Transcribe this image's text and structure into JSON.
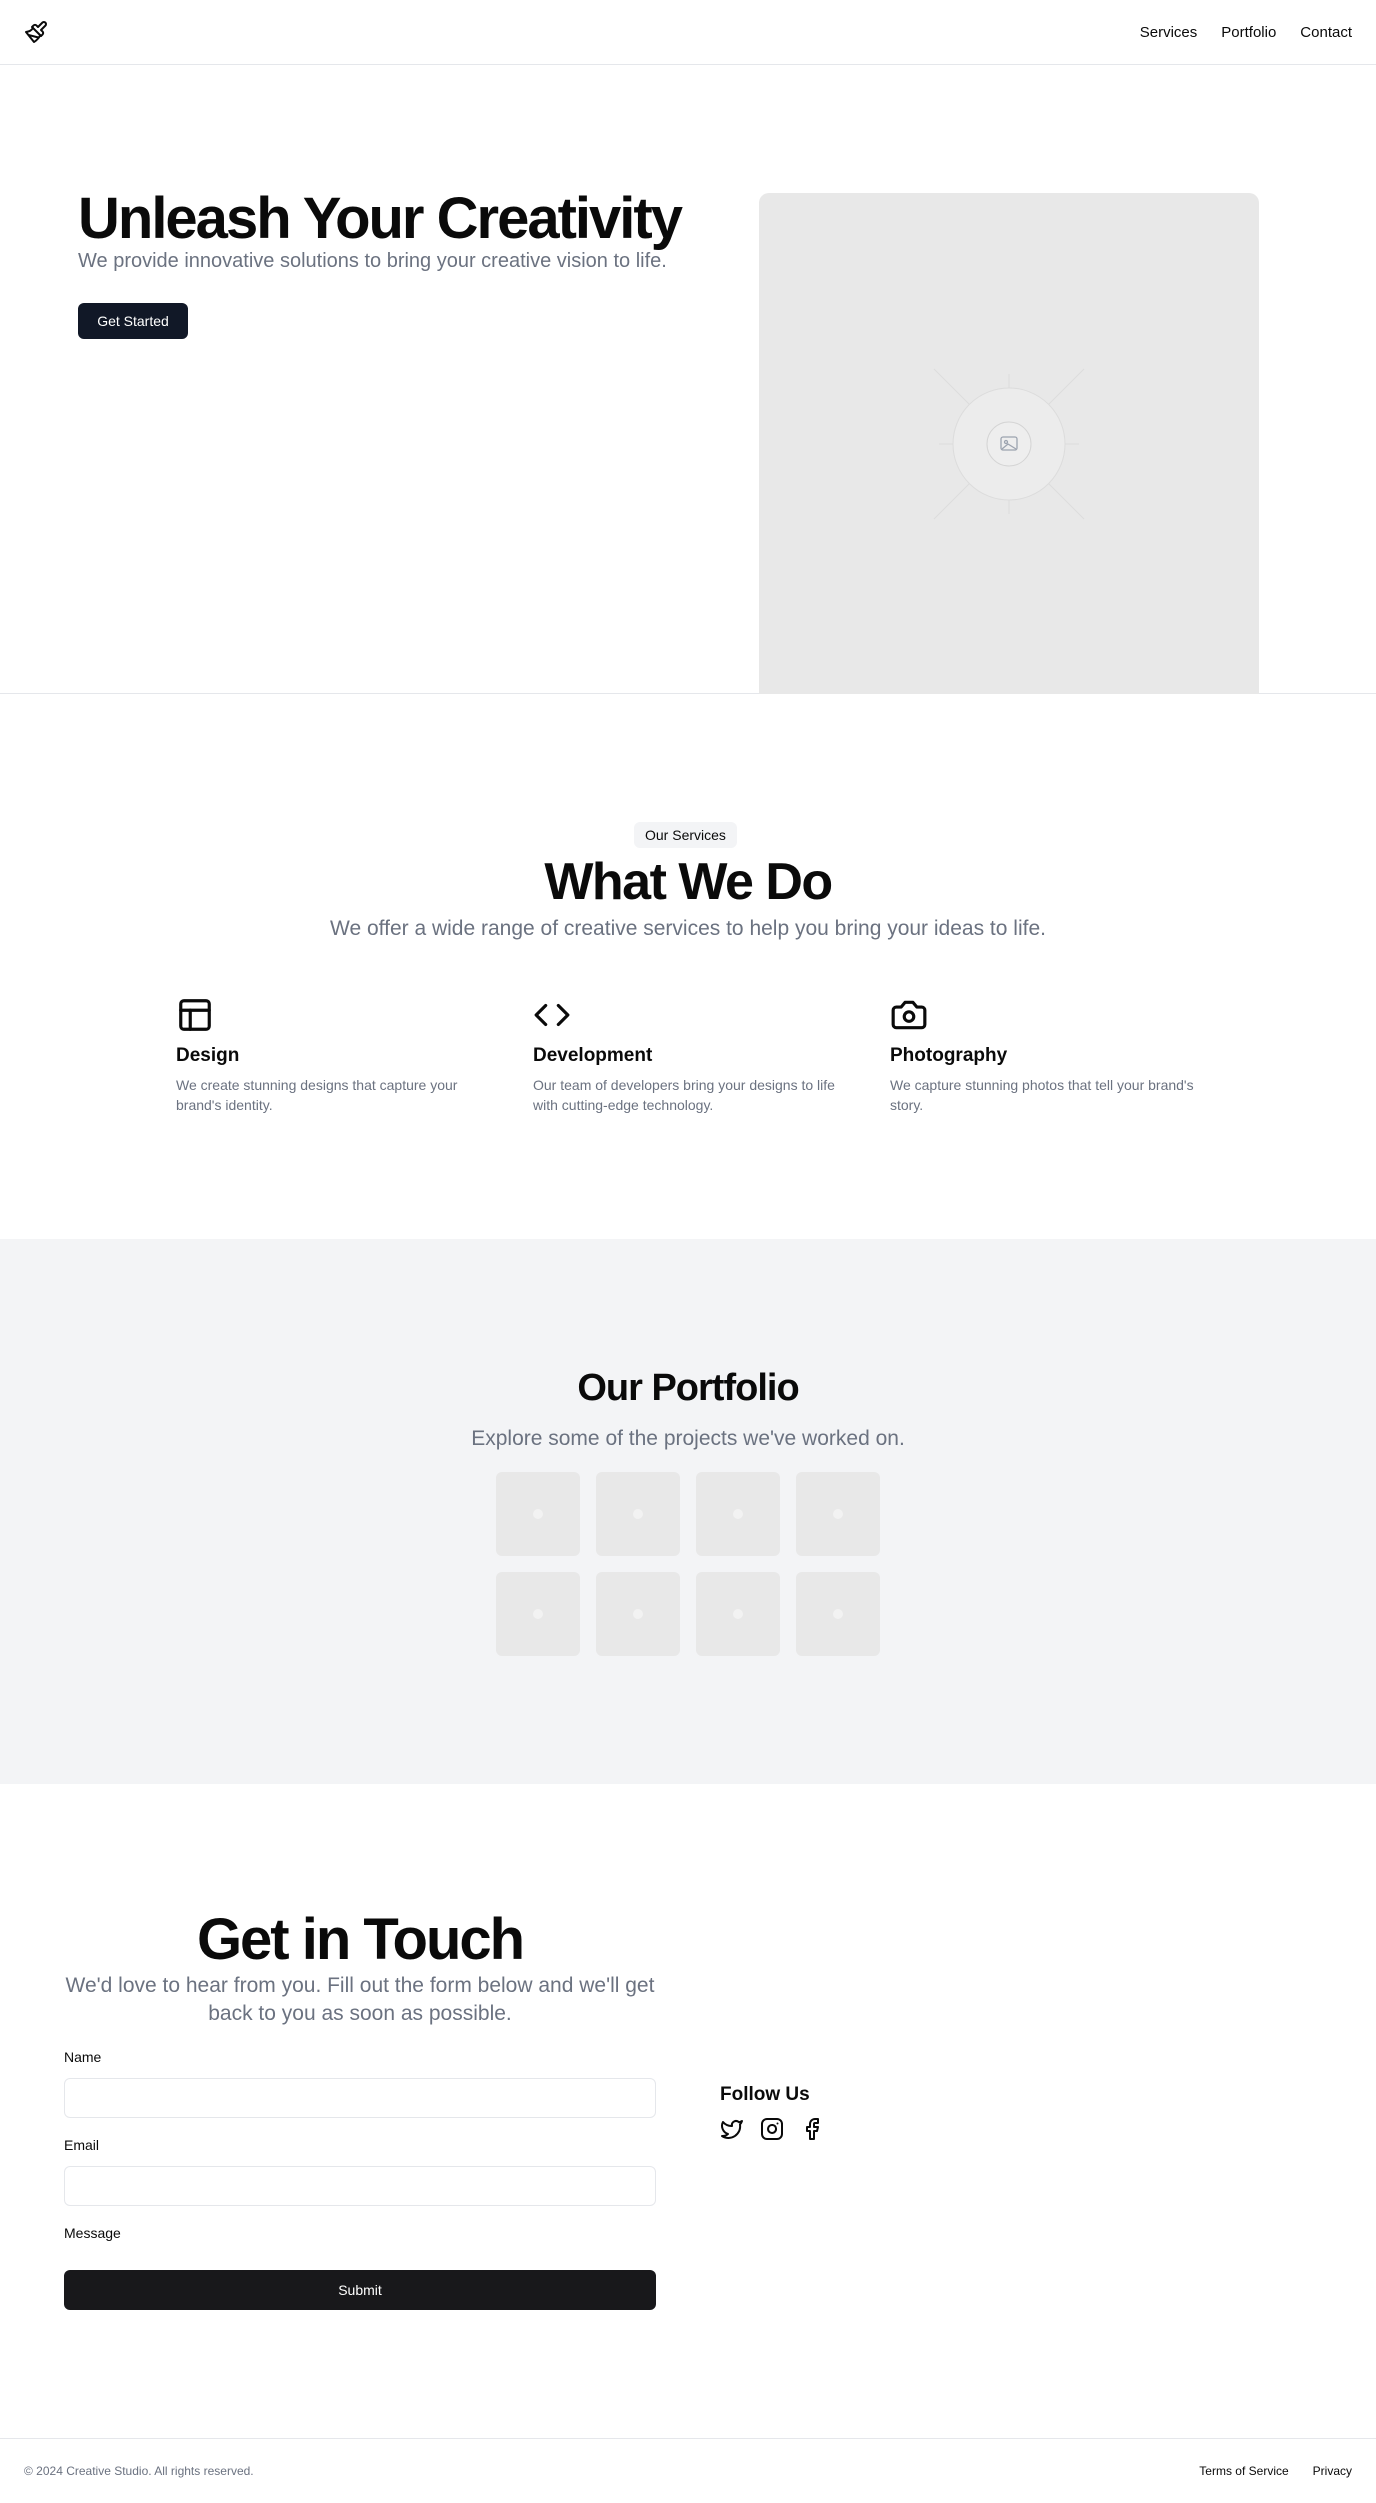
{
  "header": {
    "logo_icon": "paintbrush-icon",
    "nav": [
      "Services",
      "Portfolio",
      "Contact"
    ]
  },
  "hero": {
    "title": "Unleash Your Creativity",
    "subtitle": "We provide innovative solutions to bring your creative vision to life.",
    "cta_label": "Get Started",
    "image_icon": "image-placeholder-icon"
  },
  "services": {
    "badge": "Our Services",
    "title": "What We Do",
    "subtitle": "We offer a wide range of creative services to help you bring your ideas to life.",
    "items": [
      {
        "icon": "layout-icon",
        "title": "Design",
        "desc": "We create stunning designs that capture your brand's identity."
      },
      {
        "icon": "code-icon",
        "title": "Development",
        "desc": "Our team of developers bring your designs to life with cutting-edge technology."
      },
      {
        "icon": "camera-icon",
        "title": "Photography",
        "desc": "We capture stunning photos that tell your brand's story."
      }
    ]
  },
  "portfolio": {
    "title": "Our Portfolio",
    "subtitle": "Explore some of the projects we've worked on."
  },
  "contact": {
    "title": "Get in Touch",
    "subtitle": "We'd love to hear from you. Fill out the form below and we'll get back to you as soon as possible.",
    "name_label": "Name",
    "email_label": "Email",
    "message_label": "Message",
    "submit_label": "Submit",
    "follow_title": "Follow Us",
    "social_icons": [
      "twitter-icon",
      "instagram-icon",
      "facebook-icon"
    ]
  },
  "footer": {
    "copyright": "© 2024 Creative Studio. All rights reserved.",
    "links": [
      "Terms of Service",
      "Privacy"
    ]
  },
  "colors": {
    "primary_button": "#111827",
    "submit_button": "#18181b",
    "muted_text": "#6b7280",
    "section_bg": "#f3f4f6",
    "placeholder_bg": "#e8e8e8"
  }
}
